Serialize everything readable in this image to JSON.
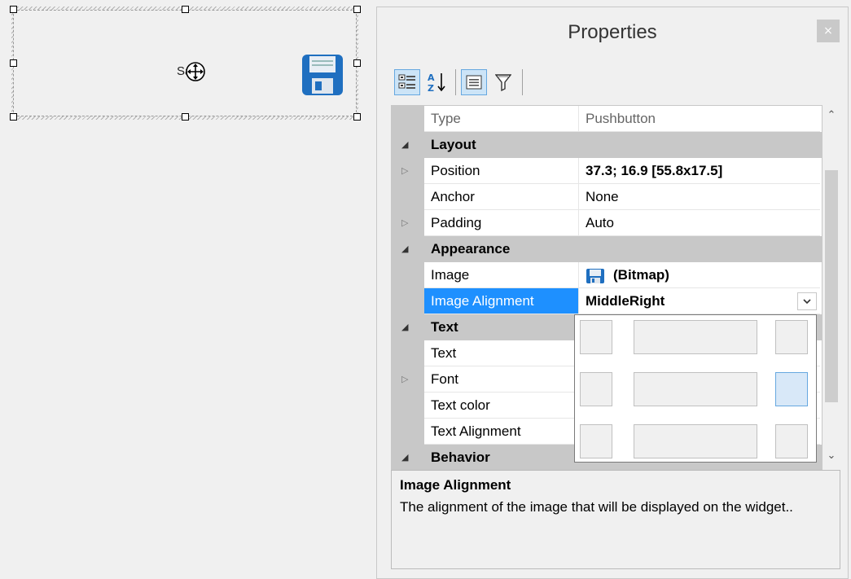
{
  "canvas": {
    "widget_text": "Save"
  },
  "panel": {
    "title": "Properties",
    "close_label": "×"
  },
  "toolbar": {
    "buttons": [
      "categorized-view",
      "alphabetical-sort",
      "properties-view",
      "filter"
    ]
  },
  "grid": {
    "type_row": {
      "name": "Type",
      "value": "Pushbutton"
    },
    "categories": {
      "layout": "Layout",
      "appearance": "Appearance",
      "text": "Text",
      "behavior": "Behavior"
    },
    "layout": {
      "position": {
        "name": "Position",
        "value": "37.3; 16.9 [55.8x17.5]"
      },
      "anchor": {
        "name": "Anchor",
        "value": "None"
      },
      "padding": {
        "name": "Padding",
        "value": "Auto"
      }
    },
    "appearance": {
      "image": {
        "name": "Image",
        "value": "(Bitmap)"
      },
      "image_alignment": {
        "name": "Image Alignment",
        "value": "MiddleRight"
      }
    },
    "text": {
      "text": {
        "name": "Text"
      },
      "font": {
        "name": "Font"
      },
      "text_color": {
        "name": "Text color"
      },
      "text_alignment": {
        "name": "Text Alignment"
      }
    }
  },
  "alignment_picker": {
    "selected": "MiddleRight"
  },
  "description": {
    "title": "Image Alignment",
    "text": "The alignment of the image that will be displayed on the widget.."
  },
  "colors": {
    "selection": "#1e90ff",
    "category_bg": "#c8c8c8",
    "toolbar_active": "#cce4f7",
    "floppy_blue": "#1f6fc0"
  }
}
